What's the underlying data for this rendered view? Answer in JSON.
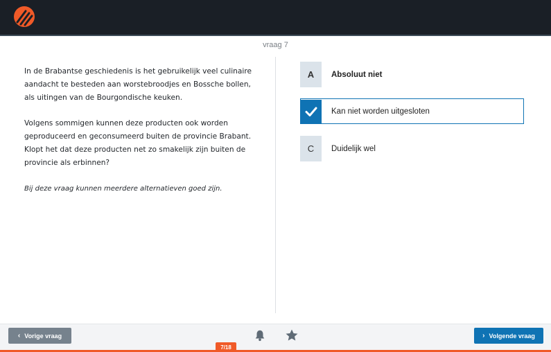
{
  "header": {
    "logo_icon": "brand-logo-icon"
  },
  "question": {
    "number_label": "vraag 7",
    "paragraphs": [
      "In de Brabantse geschiedenis is het gebruikelijk veel culinaire aandacht te besteden aan worstebroodjes en Bossche bollen, als uitingen van de Bourgondische keuken.",
      "Volgens sommigen kunnen deze producten ook worden geproduceerd en geconsumeerd buiten de provincie Brabant. Klopt het dat deze producten net zo smakelijk zijn buiten de provincie als erbinnen?"
    ],
    "note": "Bij deze vraag kunnen meerdere alternatieven goed zijn."
  },
  "options": [
    {
      "letter": "A",
      "label": "Absoluut niet",
      "selected": false
    },
    {
      "letter": "",
      "label": "Kan niet worden uitgesloten",
      "selected": true
    },
    {
      "letter": "C",
      "label": "Duidelijk wel",
      "selected": false
    }
  ],
  "footer": {
    "prev_label": "Vorige vraag",
    "next_label": "Volgende vraag",
    "progress_label": "7/18",
    "progress_fraction": 0.3889
  },
  "colors": {
    "accent_blue": "#0f73b4",
    "accent_orange": "#f05a28",
    "topbar": "#1a1f26"
  }
}
